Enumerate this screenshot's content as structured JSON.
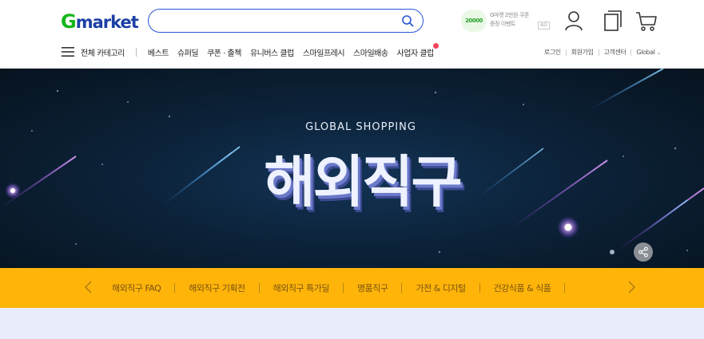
{
  "header": {
    "logo_g": "G",
    "logo_rest": "market",
    "search": {
      "placeholder": "",
      "value": ""
    },
    "coupon": {
      "amount": "20000",
      "line1": "G마켓 2만원 쿠폰",
      "line2": "증정 이벤트",
      "ad": "AD"
    },
    "icons": [
      "user-icon",
      "recent-icon",
      "cart-icon"
    ],
    "brand_green": "#16b51c",
    "brand_blue": "#1c3fa6"
  },
  "nav": {
    "all_categories": "전체 카테고리",
    "items": [
      "베스트",
      "슈퍼딜",
      "쿠폰 · 출첵",
      "유니버스 클럽",
      "스마일프레시",
      "스마일배송",
      "사업자 클럽"
    ]
  },
  "util": {
    "items": [
      "로그인",
      "회원가입",
      "고객센터",
      "Global"
    ]
  },
  "hero": {
    "subtitle": "GLOBAL SHOPPING",
    "title": "해외직구"
  },
  "category_bar": {
    "color": "#ffb40a",
    "items": [
      "해외직구 FAQ",
      "해외직구 기획전",
      "해외직구 특가딜",
      "명품직구",
      "가전 & 디지털",
      "건강식품 & 식품"
    ]
  }
}
